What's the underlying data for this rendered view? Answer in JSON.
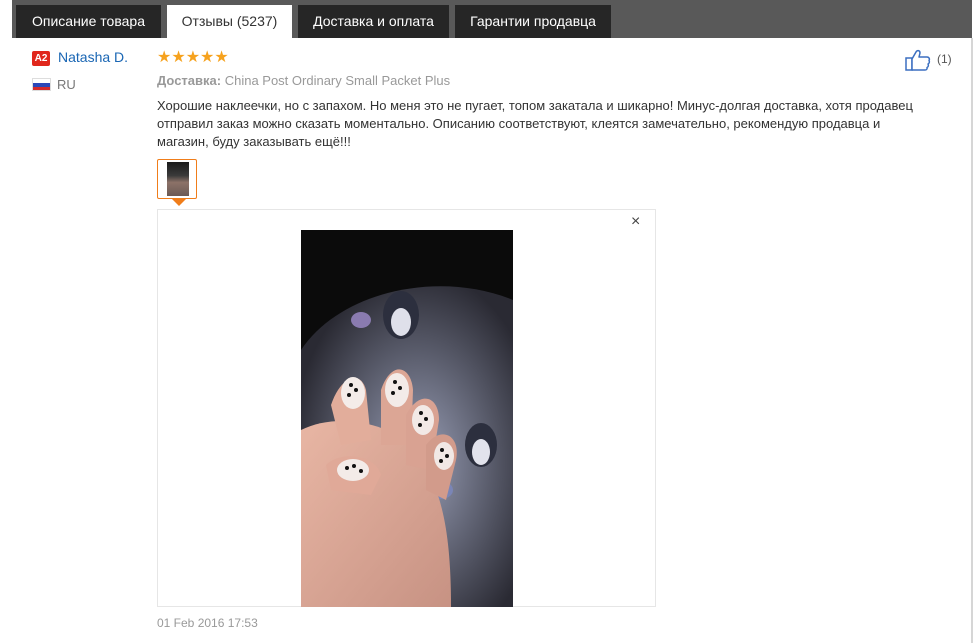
{
  "tabs": [
    {
      "label": "Описание товара",
      "active": false
    },
    {
      "label": "Отзывы (5237)",
      "active": true
    },
    {
      "label": "Доставка и оплата",
      "active": false
    },
    {
      "label": "Гарантии продавца",
      "active": false
    }
  ],
  "review": {
    "user_badge": "A2",
    "user_name": "Natasha D.",
    "country": "RU",
    "rating": 5,
    "stars": "★★★★★",
    "delivery_label": "Доставка:",
    "delivery_value": "China Post Ordinary Small Packet Plus",
    "text": "Хорошие наклеечки, но с запахом. Но меня это не пугает, топом закатала и шикарно! Минус-долгая доставка, хотя продавец отправил заказ можно сказать моментально. Описанию соответствуют, клеятся замечательно, рекомендую продавца и магазин, буду заказывать ещё!!!",
    "helpful_count": "(1)",
    "close_glyph": "×",
    "date": "01 Feb 2016 17:53"
  },
  "colors": {
    "tab_bar": "#595959",
    "tab": "#262626",
    "badge": "#e0271c",
    "link": "#1a66b4",
    "stars": "#f6a21e",
    "thumb_border": "#f07d1a"
  },
  "icons": {
    "helpful": "thumbs-up-icon",
    "close": "close-icon",
    "flag": "russia-flag-icon"
  }
}
